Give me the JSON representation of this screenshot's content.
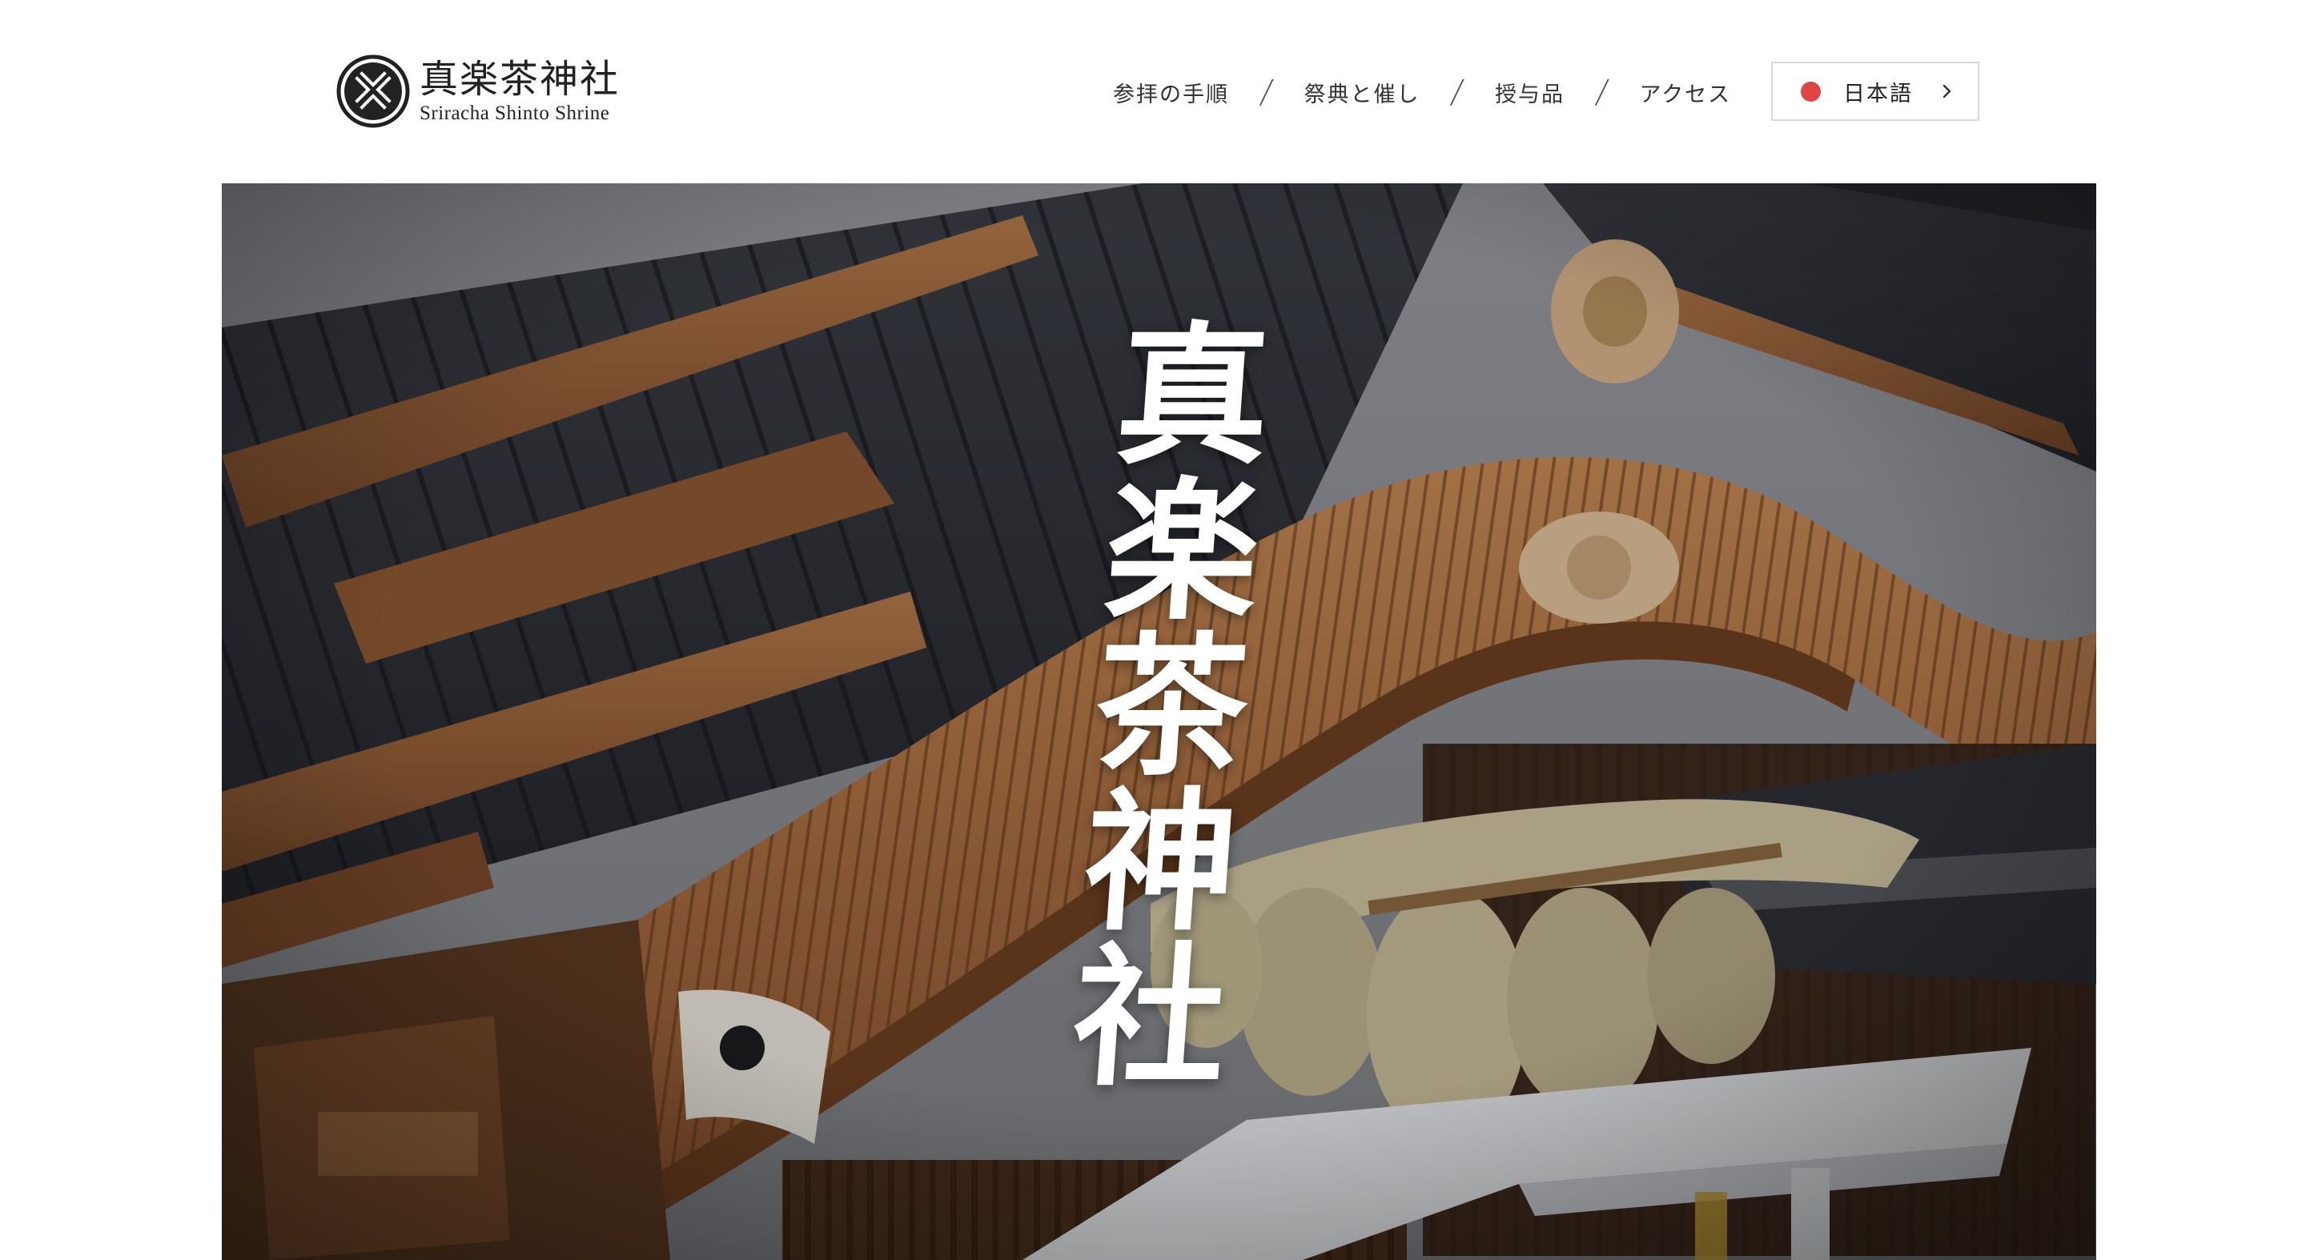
{
  "site": {
    "logo_jp": "真楽茶神社",
    "logo_en": "Sriracha Shinto Shrine"
  },
  "nav": {
    "items": [
      {
        "label": "参拝の手順"
      },
      {
        "label": "祭典と催し"
      },
      {
        "label": "授与品"
      },
      {
        "label": "アクセス"
      }
    ],
    "separator": "/"
  },
  "language": {
    "label": "日本語",
    "indicator_color": "#e04545"
  },
  "hero": {
    "title": "真楽茶神社",
    "image": "shrine-roof-illustration"
  },
  "icons": {
    "logo": "shrine-crest-icon",
    "lang_dot": "red-circle-icon",
    "lang_arrow": "chevron-right-icon"
  }
}
